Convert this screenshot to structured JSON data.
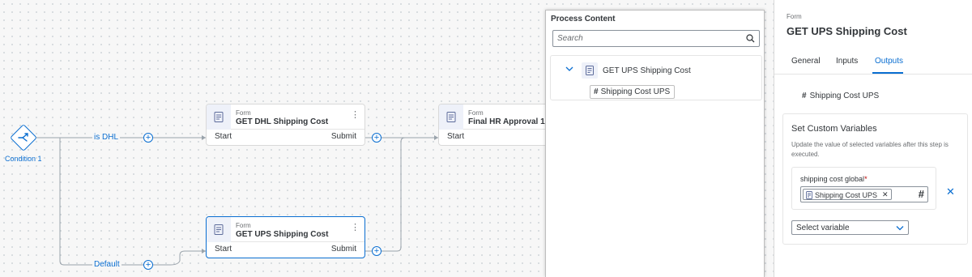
{
  "canvas": {
    "condition": {
      "label": "Condition 1",
      "icon": "branch-icon"
    },
    "wire_labels": {
      "dhl": "is DHL",
      "default": "Default"
    },
    "cards": [
      {
        "kind": "Form",
        "name": "GET DHL Shipping Cost",
        "start": "Start",
        "submit": "Submit"
      },
      {
        "kind": "Form",
        "name": "Final HR Approval 1",
        "start": "Start"
      },
      {
        "kind": "Form",
        "name": "GET UPS Shipping Cost",
        "start": "Start",
        "submit": "Submit"
      }
    ]
  },
  "process_content": {
    "title": "Process Content",
    "search_placeholder": "Search",
    "tree": {
      "form_name": "GET UPS Shipping Cost",
      "variable": "Shipping Cost UPS"
    }
  },
  "panel": {
    "kind": "Form",
    "title": "GET UPS Shipping Cost",
    "tabs": [
      {
        "label": "General",
        "active": false
      },
      {
        "label": "Inputs",
        "active": false
      },
      {
        "label": "Outputs",
        "active": true
      }
    ],
    "output_variable": "Shipping Cost UPS",
    "custom_vars": {
      "title": "Set Custom Variables",
      "description": "Update the value of selected variables after this step is executed.",
      "field_label": "shipping cost global",
      "required_mark": "*",
      "token": "Shipping Cost UPS",
      "select_placeholder": "Select variable"
    }
  },
  "colors": {
    "accent": "#0a6ed1",
    "card_icon_bg": "#eef1f9",
    "required": "#bb0000"
  }
}
